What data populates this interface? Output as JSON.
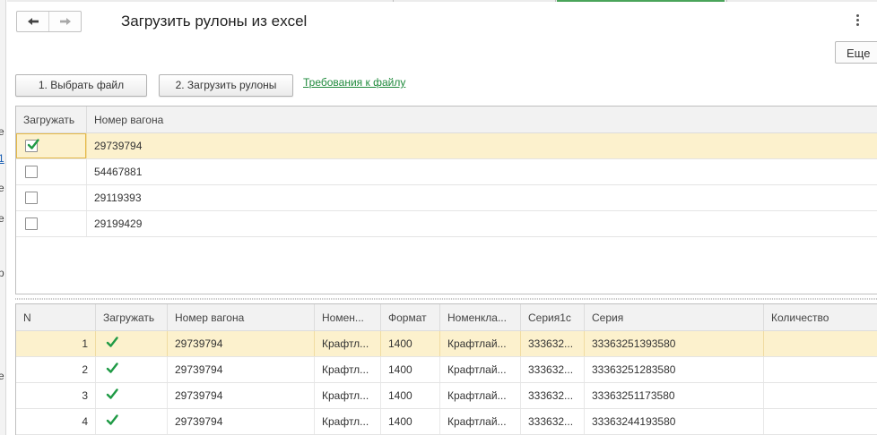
{
  "window": {
    "title": "Загрузить рулоны из excel",
    "more_label": "Еще",
    "side_fragment": [
      "е",
      "1",
      "е",
      "е",
      "р",
      "е"
    ]
  },
  "toolbar": {
    "back_icon": "arrow-left-icon",
    "forward_icon": "arrow-right-icon",
    "choose_file_label": "1. Выбрать файл",
    "load_rolls_label": "2. Загрузить рулоны",
    "requirements_link": "Требования к файлу"
  },
  "colors": {
    "selected_row": "#fcf1cd",
    "link": "#1f8a3c",
    "check": "#1f9a45",
    "header_bg": "#f2f2f2"
  },
  "wagons_table": {
    "columns": [
      "Загружать",
      "Номер вагона"
    ],
    "rows": [
      {
        "load": true,
        "wagon": "29739794",
        "selected": true
      },
      {
        "load": false,
        "wagon": "54467881",
        "selected": false
      },
      {
        "load": false,
        "wagon": "29119393",
        "selected": false
      },
      {
        "load": false,
        "wagon": "29199429",
        "selected": false
      }
    ]
  },
  "rolls_table": {
    "columns": [
      "N",
      "Загружать",
      "Номер вагона",
      "Номен...",
      "Формат",
      "Номенкла...",
      "Серия1с",
      "Серия",
      "Количество"
    ],
    "rows": [
      {
        "n": "1",
        "load": true,
        "wagon": "29739794",
        "nomen": "Крафтл...",
        "format": "1400",
        "nomen2": "Крафтлай...",
        "series1c": "333632...",
        "series": "33363251393580",
        "qty": "",
        "selected": true
      },
      {
        "n": "2",
        "load": true,
        "wagon": "29739794",
        "nomen": "Крафтл...",
        "format": "1400",
        "nomen2": "Крафтлай...",
        "series1c": "333632...",
        "series": "33363251283580",
        "qty": "",
        "selected": false
      },
      {
        "n": "3",
        "load": true,
        "wagon": "29739794",
        "nomen": "Крафтл...",
        "format": "1400",
        "nomen2": "Крафтлай...",
        "series1c": "333632...",
        "series": "33363251173580",
        "qty": "",
        "selected": false
      },
      {
        "n": "4",
        "load": true,
        "wagon": "29739794",
        "nomen": "Крафтл...",
        "format": "1400",
        "nomen2": "Крафтлай...",
        "series1c": "333632...",
        "series": "33363244193580",
        "qty": "",
        "selected": false
      }
    ]
  }
}
